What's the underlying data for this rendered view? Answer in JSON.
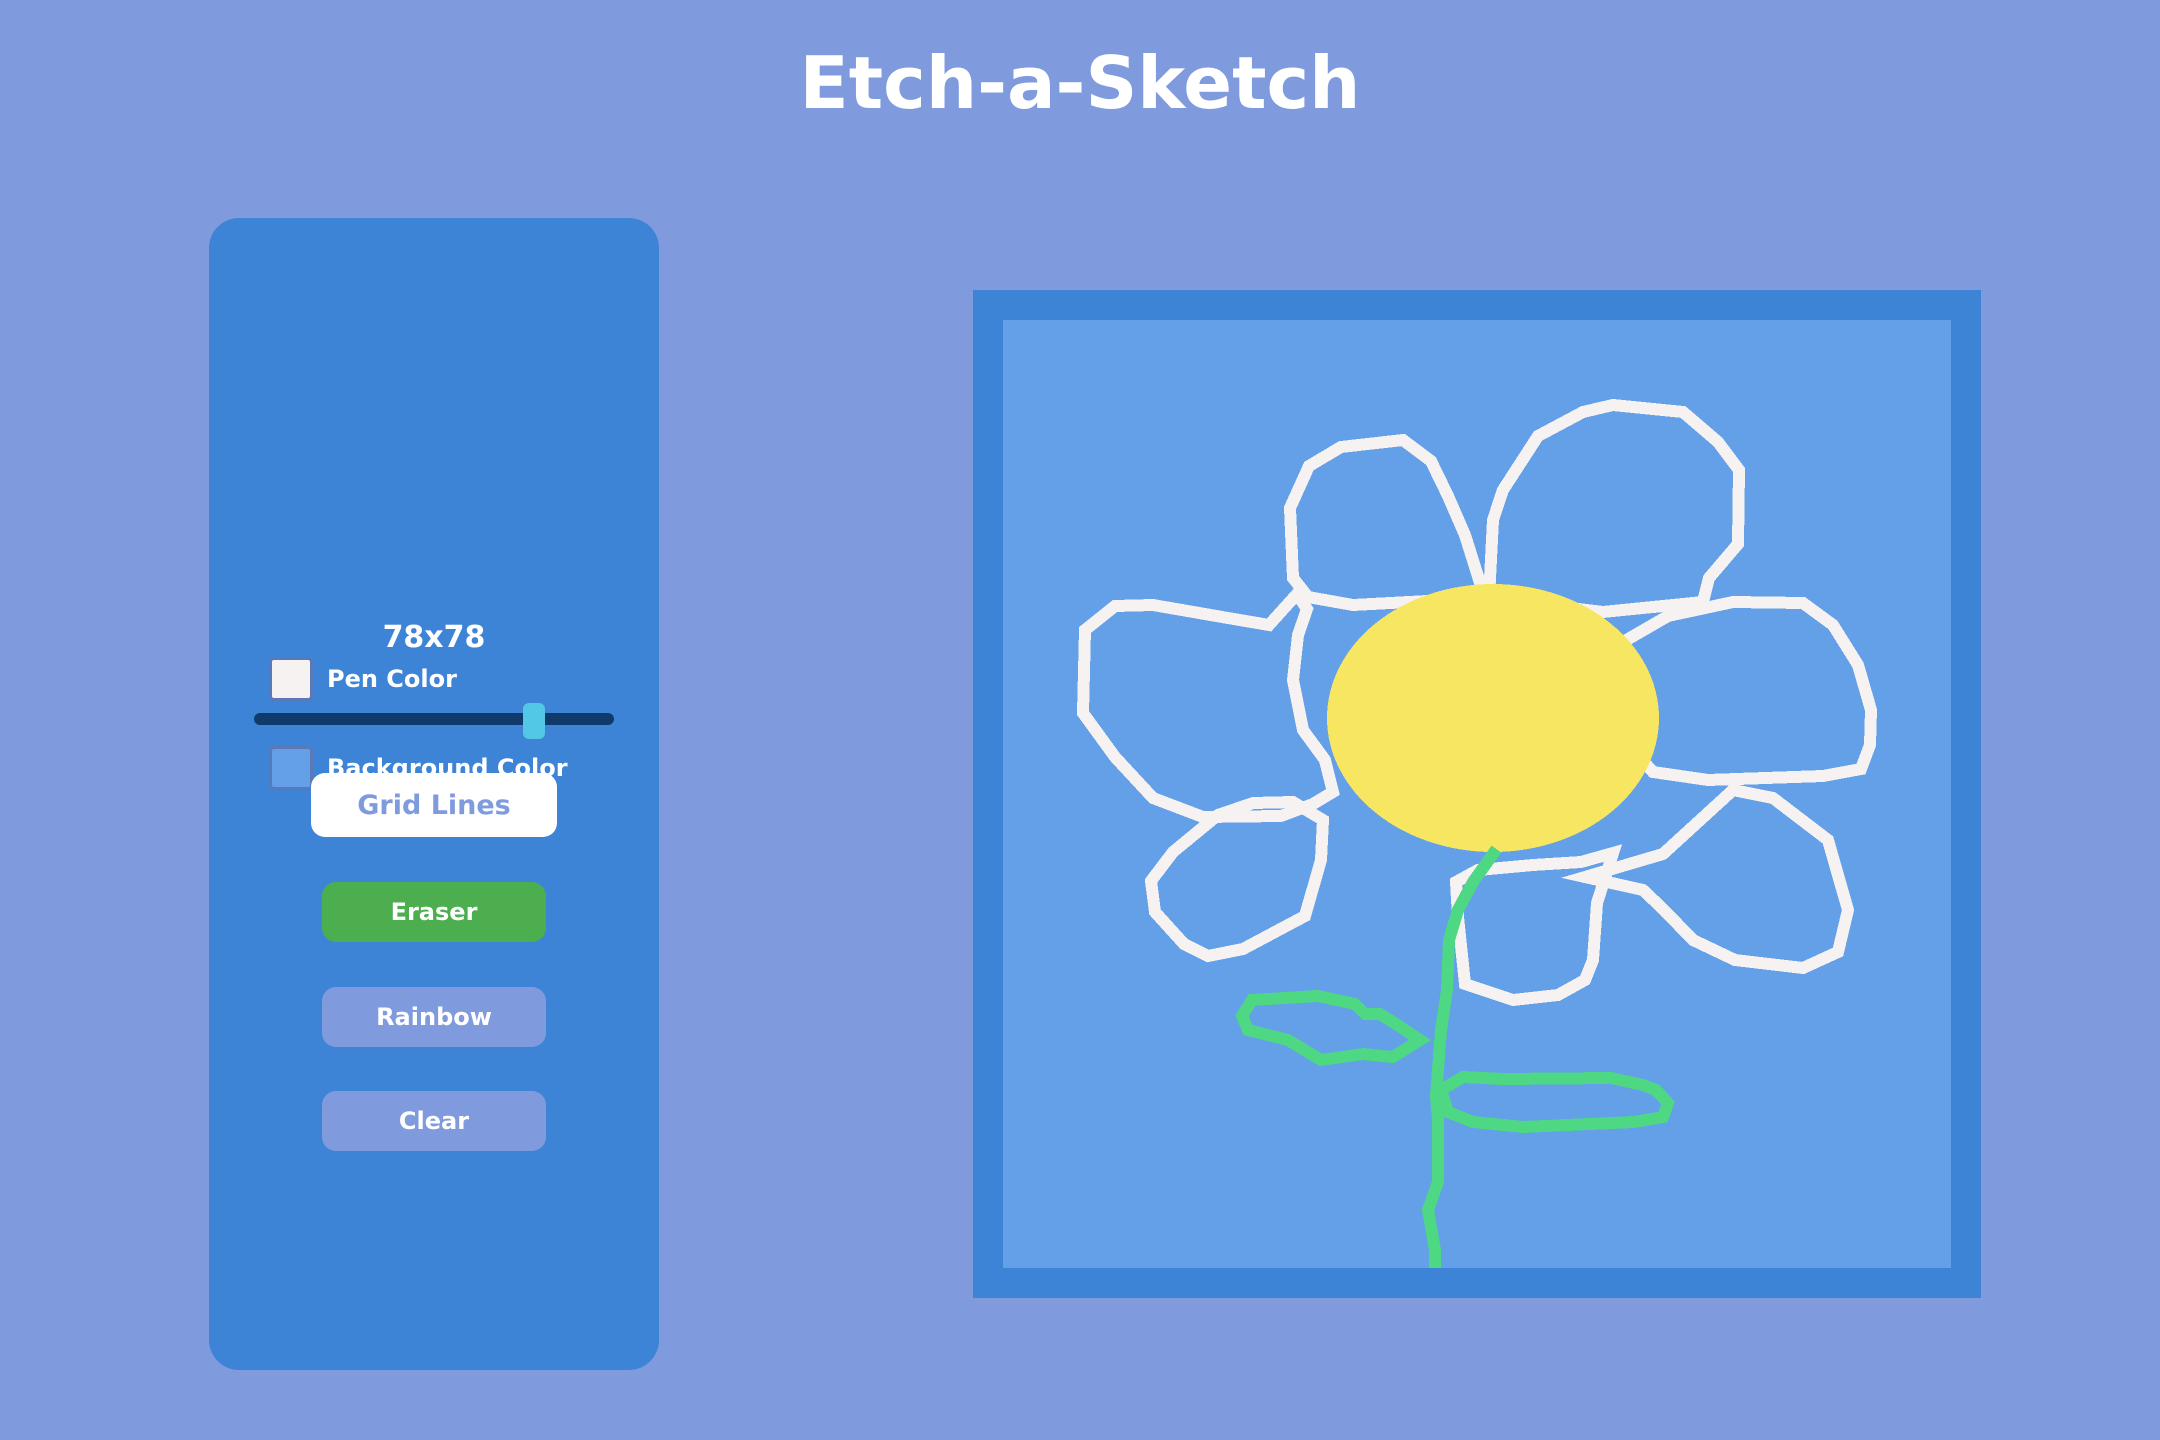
{
  "app": {
    "title": "Etch-a-Sketch"
  },
  "controls": {
    "pen_color": {
      "label": "Pen Color",
      "value": "#f6f2f2"
    },
    "background_color": {
      "label": "Background Color",
      "value": "#63a0e8"
    },
    "grid_size_label": "78x78",
    "grid_size_value": 78,
    "grid_size_min": 1,
    "grid_size_max": 100,
    "buttons": {
      "grid_lines": "Grid Lines",
      "eraser": "Eraser",
      "rainbow": "Rainbow",
      "clear": "Clear"
    }
  },
  "theme": {
    "page_background": "#7f9bde",
    "panel_background": "#3d84d6",
    "eraser_button": "#4cae4f",
    "slider_thumb": "#53c8e6"
  },
  "drawing": {
    "subject": "daisy flower",
    "petal_color": "#f6f2f2",
    "center_color": "#f7e662",
    "stem_color": "#4ed884"
  }
}
